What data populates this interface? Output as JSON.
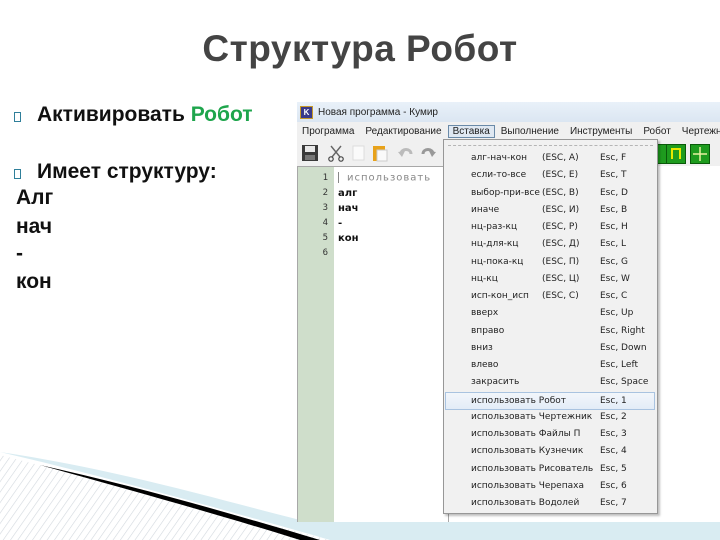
{
  "slide": {
    "title": "Структура Робот",
    "bullets": [
      {
        "prefix": "Активировать ",
        "highlight": "Робот"
      },
      {
        "prefix": "Имеет структуру:",
        "highlight": ""
      }
    ],
    "structure_lines": [
      "Алг",
      "нач",
      "-",
      "кон"
    ],
    "accent_color": "#1ea54c"
  },
  "window": {
    "app_icon": "K",
    "title": "Новая программа - Кумир",
    "menu": [
      {
        "label": "Программа",
        "active": false
      },
      {
        "label": "Редактирование",
        "active": false
      },
      {
        "label": "Вставка",
        "active": true
      },
      {
        "label": "Выполнение",
        "active": false
      },
      {
        "label": "Инструменты",
        "active": false
      },
      {
        "label": "Робот",
        "active": false
      },
      {
        "label": "Чертежник",
        "active": false
      }
    ],
    "toolbar": [
      "save-icon",
      "cut-icon",
      "copy-icon",
      "paste-icon",
      "undo-icon",
      "redo-icon"
    ],
    "editor": {
      "line_numbers": [
        "1",
        "2",
        "3",
        "4",
        "5",
        "6"
      ],
      "lines": [
        "использовать",
        "алг",
        "нач",
        "-",
        "кон",
        ""
      ]
    },
    "insert_menu": [
      {
        "label": "алг-нач-кон",
        "esc": "(ESC, A)",
        "key": "Esc, F"
      },
      {
        "label": "если-то-все",
        "esc": "(ESC, E)",
        "key": "Esc, T"
      },
      {
        "label": "выбор-при-все",
        "esc": "(ESC, B)",
        "key": "Esc, D"
      },
      {
        "label": "иначе",
        "esc": "(ESC, И)",
        "key": "Esc, B"
      },
      {
        "label": "нц-раз-кц",
        "esc": "(ESC, P)",
        "key": "Esc, H"
      },
      {
        "label": "нц-для-кц",
        "esc": "(ESC, Д)",
        "key": "Esc, L"
      },
      {
        "label": "нц-пока-кц",
        "esc": "(ESC, П)",
        "key": "Esc, G"
      },
      {
        "label": "нц-кц",
        "esc": "(ESC, Ц)",
        "key": "Esc, W"
      },
      {
        "label": "исп-кон_исп",
        "esc": "(ESC, C)",
        "key": "Esc, C"
      },
      {
        "label": "вверх",
        "esc": "",
        "key": "Esc, Up"
      },
      {
        "label": "вправо",
        "esc": "",
        "key": "Esc, Right"
      },
      {
        "label": "вниз",
        "esc": "",
        "key": "Esc, Down"
      },
      {
        "label": "влево",
        "esc": "",
        "key": "Esc, Left"
      },
      {
        "label": "закрасить",
        "esc": "",
        "key": "Esc, Space"
      },
      {
        "label": "использовать Робот",
        "esc": "",
        "key": "Esc, 1",
        "highlight": true
      },
      {
        "label": "использовать Чертежник",
        "esc": "",
        "key": "Esc, 2"
      },
      {
        "label": "использовать Файлы П",
        "esc": "",
        "key": "Esc, 3"
      },
      {
        "label": "использовать Кузнечик",
        "esc": "",
        "key": "Esc, 4"
      },
      {
        "label": "использовать Рисователь",
        "esc": "",
        "key": "Esc, 5"
      },
      {
        "label": "использовать Черепаха",
        "esc": "",
        "key": "Esc, 6"
      },
      {
        "label": "использовать Водолей",
        "esc": "",
        "key": "Esc, 7"
      }
    ]
  }
}
